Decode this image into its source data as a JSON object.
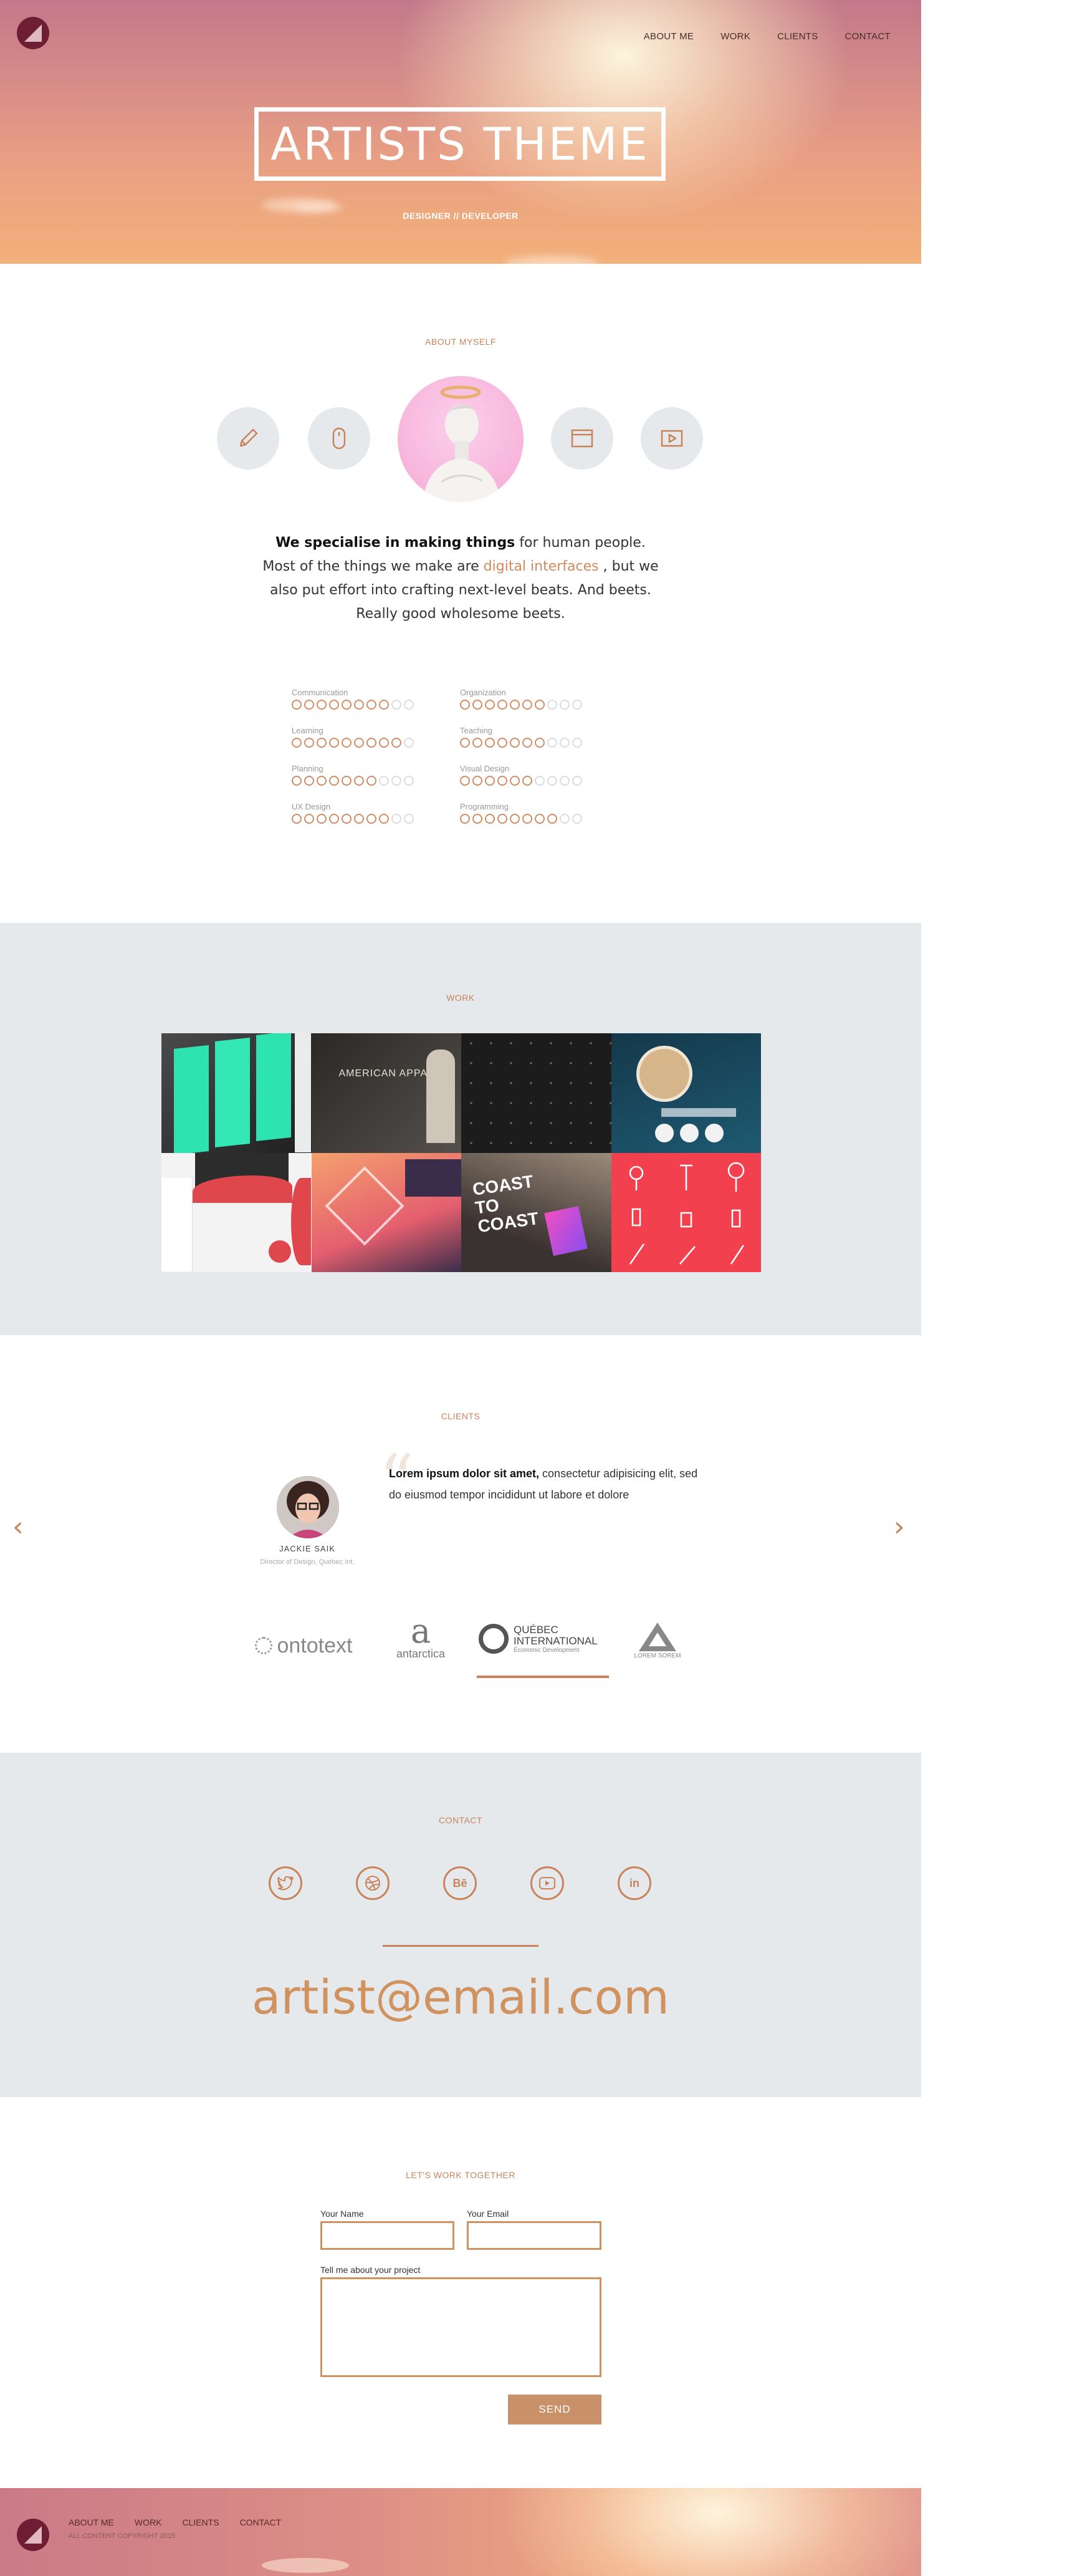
{
  "nav": [
    "ABOUT ME",
    "WORK",
    "CLIENTS",
    "CONTACT"
  ],
  "hero": {
    "title": "ARTISTS THEME",
    "subtitle": "DESIGNER // DEVELOPER"
  },
  "about": {
    "label": "ABOUT MYSELF",
    "icons": [
      "pencil-icon",
      "mouse-icon",
      "browser-window-icon",
      "video-play-icon"
    ],
    "text_bold": "We specialise in making things",
    "text_1": " for human people. Most of the things we make are ",
    "text_highlight": "digital interfaces",
    "text_2": " , but we also put effort into crafting next-level beats. And beets. Really good wholesome beets."
  },
  "skills": [
    {
      "name": "Communication",
      "level": 8,
      "max": 10
    },
    {
      "name": "Organization",
      "level": 7,
      "max": 10
    },
    {
      "name": "Learning",
      "level": 9,
      "max": 10
    },
    {
      "name": "Teaching",
      "level": 7,
      "max": 10
    },
    {
      "name": "Planning",
      "level": 7,
      "max": 10
    },
    {
      "name": "Visual Design",
      "level": 6,
      "max": 10
    },
    {
      "name": "UX Design",
      "level": 8,
      "max": 10
    },
    {
      "name": "Programming",
      "level": 8,
      "max": 10
    }
  ],
  "work": {
    "label": "WORK",
    "tiles": [
      {
        "name": "mobile-app-screens",
        "bg": "#2b2b2b",
        "accent": "#2de3b0"
      },
      {
        "name": "american-apparel",
        "bg": "#3a3634",
        "accent": "#d9d2c8",
        "text": "AMERICAN APPAREL"
      },
      {
        "name": "icon-pattern",
        "bg": "#1e1e1e",
        "accent": "#b08a5a"
      },
      {
        "name": "profile-app",
        "bg": "#1b4a5e",
        "accent": "#d7b58a"
      },
      {
        "name": "dashboard-ui",
        "bg": "#f4f4f4",
        "accent": "#e0474c"
      },
      {
        "name": "map-app",
        "bg": "#e86a6a",
        "accent": "#f7b07a"
      },
      {
        "name": "coast-to-coast",
        "bg": "#3a3230",
        "accent": "#e94fb0",
        "text": "COAST TO COAST"
      },
      {
        "name": "beauty-icons",
        "bg": "#f2404f",
        "accent": "#ffffff"
      }
    ]
  },
  "clients": {
    "label": "CLIENTS",
    "person": {
      "name": "JACKIE SAIK",
      "role": "Director of Design, Quebec Int."
    },
    "quote_bold": "Lorem ipsum dolor sit amet,",
    "quote_rest": " consectetur adipisicing elit, sed do eiusmod tempor incididunt ut labore et dolore",
    "logos": [
      {
        "text": "ontotext"
      },
      {
        "text": "antarctica"
      },
      {
        "text": "QUÉBEC INTERNATIONAL",
        "sub": "Économic Development"
      },
      {
        "text": "LOREM SOREM"
      }
    ]
  },
  "contact": {
    "label": "CONTACT",
    "socials": [
      "twitter-icon",
      "dribbble-icon",
      "behance-icon",
      "youtube-icon",
      "linkedin-icon"
    ],
    "behance_text": "Bē",
    "linkedin_text": "in",
    "email": "artist@email.com"
  },
  "form": {
    "label": "LET'S WORK TOGETHER",
    "name_label": "Your Name",
    "email_label": "Your Email",
    "project_label": "Tell me about your project",
    "send": "SEND"
  },
  "footer": {
    "nav": [
      "ABOUT ME",
      "WORK",
      "CLIENTS",
      "CONTACT"
    ],
    "copyright": "ALL CONTENT COPYRIGHT 2015"
  },
  "colors": {
    "accent": "#c8835a",
    "section_bg": "#e5e9ec"
  }
}
